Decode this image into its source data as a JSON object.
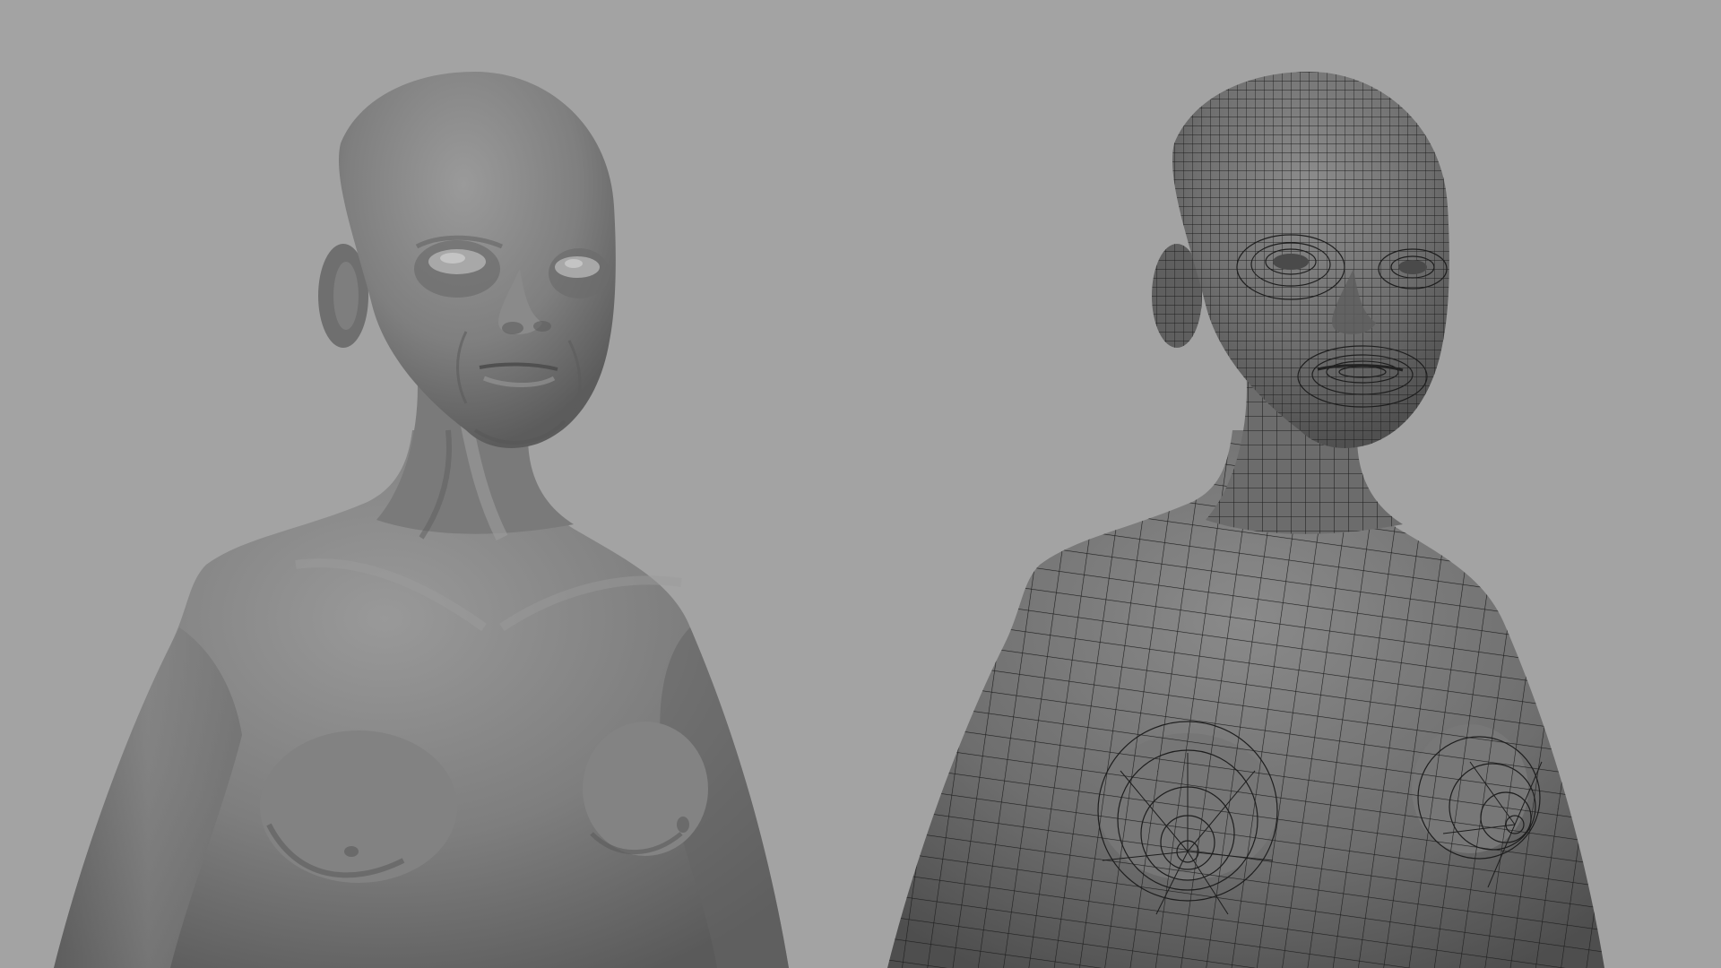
{
  "viewport": {
    "background_color": "#a3a3a3",
    "models": [
      {
        "id": "sculpt",
        "shading": "smooth-shaded",
        "base_color": "#7c7c7c"
      },
      {
        "id": "retopology",
        "shading": "wireframe-on-shaded",
        "base_color": "#6e6e6e",
        "wire_color": "#1e1e1e"
      }
    ]
  }
}
